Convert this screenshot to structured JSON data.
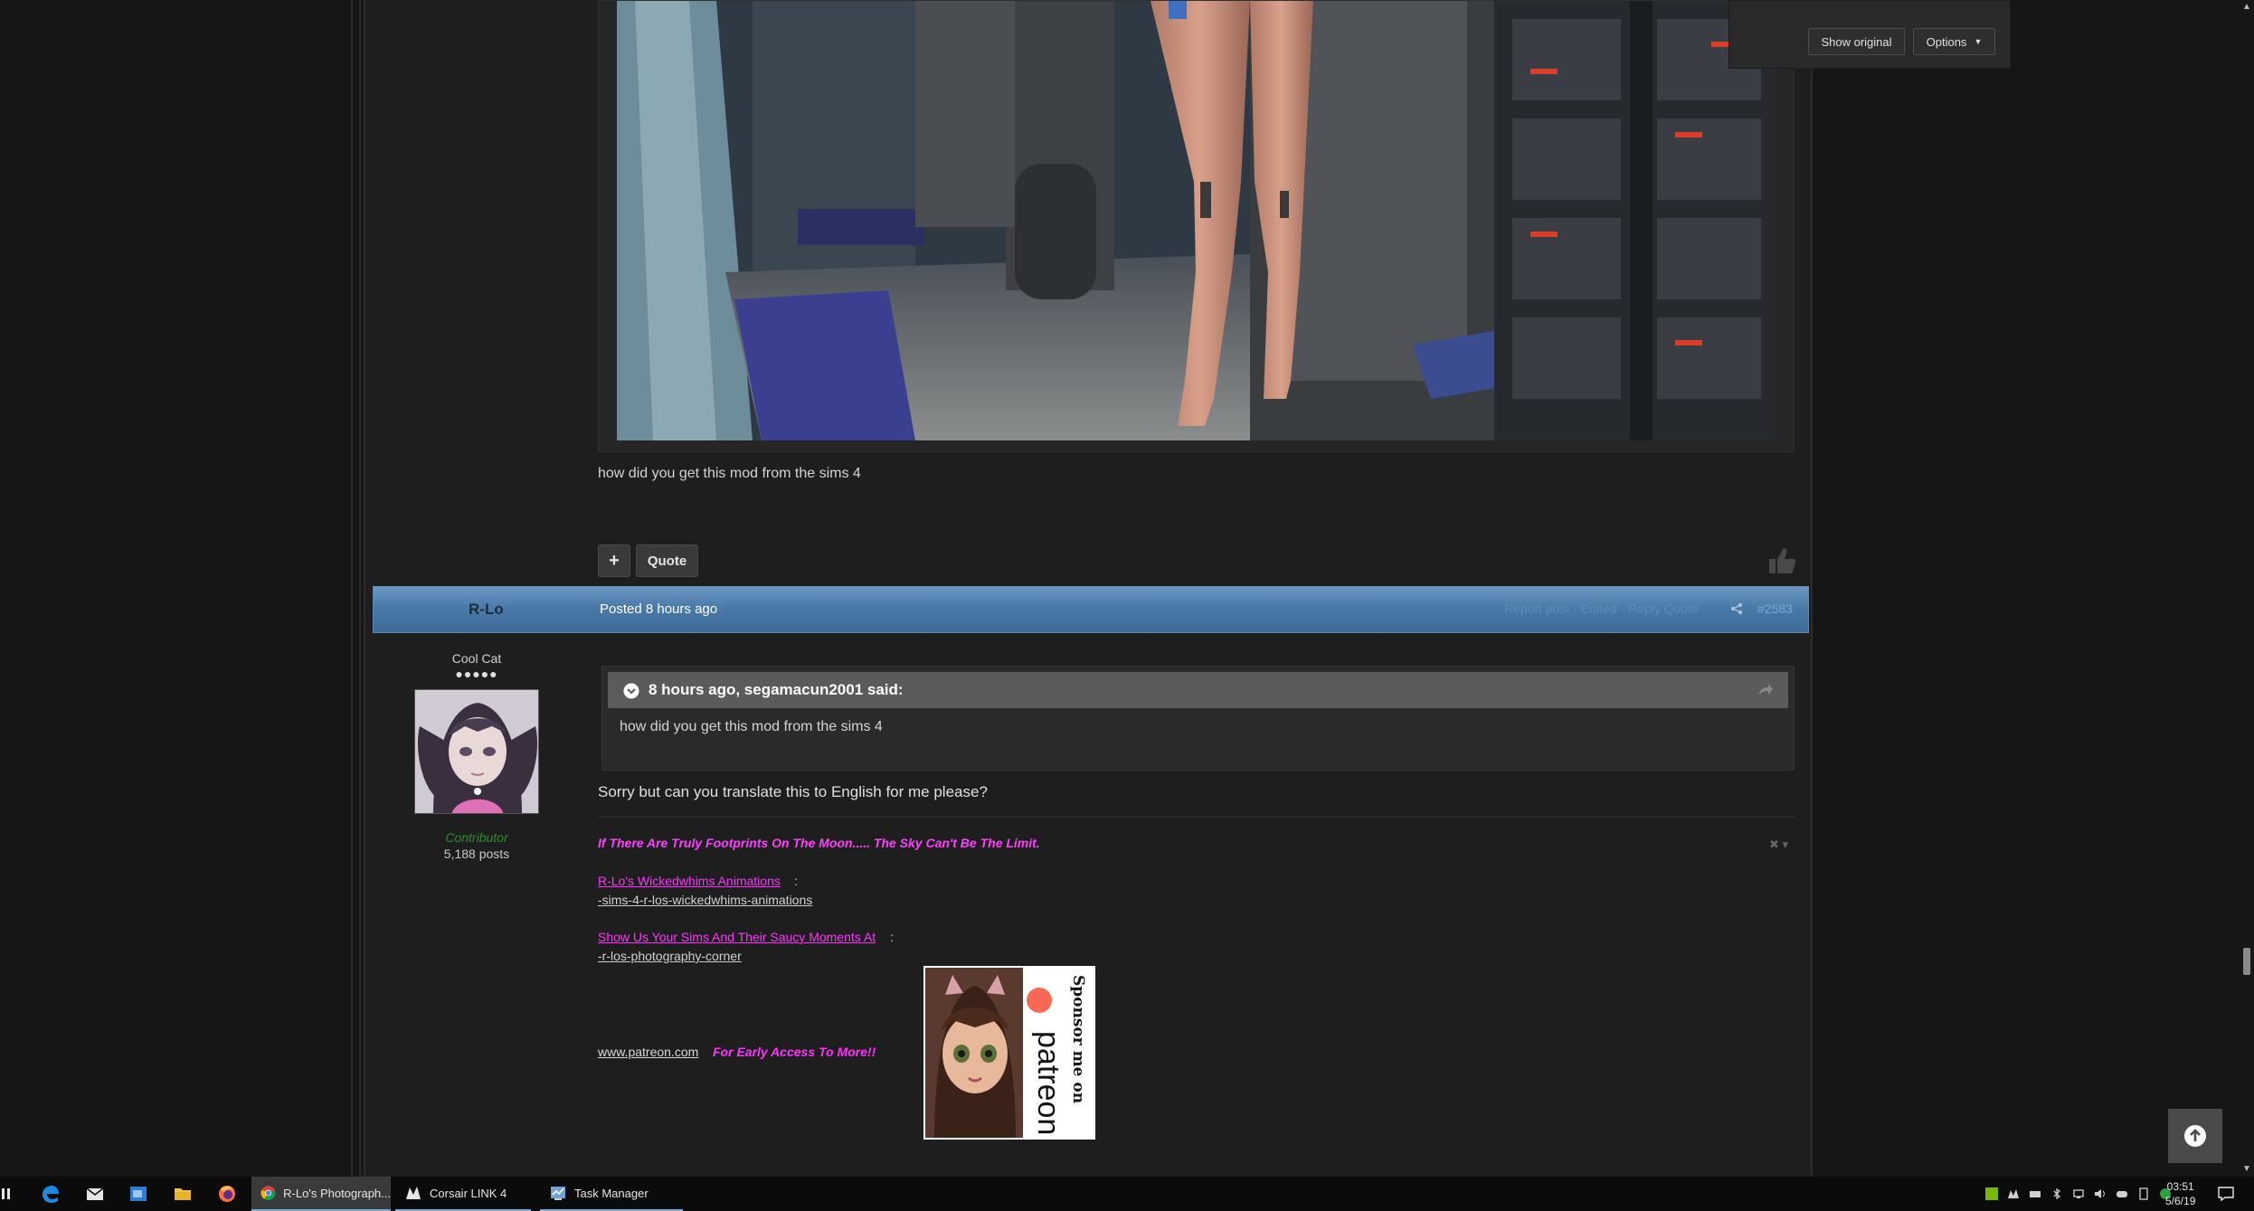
{
  "previous_post": {
    "text": "how did you get this mod from the sims 4",
    "quote_label": "Quote",
    "plus_label": "+"
  },
  "post": {
    "author": "R-Lo",
    "posted": "Posted 8 hours ago",
    "header_faded_text": "Report post · Edited · Reply Quote",
    "number": "#2583",
    "author_title": "Cool Cat",
    "author_pips": "●●●●●",
    "author_group": "Contributor",
    "author_posts": "5,188 posts",
    "quote": {
      "cite": "8 hours ago, segamacun2001 said:",
      "body": "how did you get this mod from the sims 4"
    },
    "reply": "Sorry but can you translate this to English for me please?",
    "signature": {
      "motto": "If There Are Truly Footprints On The Moon..... The Sky Can't Be The Limit.",
      "close_label": "✖ ▾",
      "link1": "R-Lo's Wickedwhims Animations",
      "sep1": ":",
      "sublink1": "-sims-4-r-los-wickedwhims-animations",
      "link2": "Show Us Your Sims And Their Saucy Moments At",
      "sep2": ":",
      "sublink2": "-r-los-photography-corner",
      "patreon_link": "www.patreon.com",
      "patreon_tag": "For Early Access To More!!",
      "banner_text_1": "Sponsor me on",
      "banner_text_2": "patreon"
    }
  },
  "translate_popup": {
    "show_original": "Show original",
    "options": "Options"
  },
  "taskbar": {
    "apps": [
      {
        "label": "R-Lo's Photograph..."
      },
      {
        "label": "Corsair LINK 4"
      },
      {
        "label": "Task Manager"
      }
    ],
    "time": "03:51",
    "date": "5/6/19"
  },
  "colors": {
    "header_blue": "#4a7aa8",
    "signature_magenta": "#ff33ff",
    "contributor_green": "#2a8f2a"
  }
}
